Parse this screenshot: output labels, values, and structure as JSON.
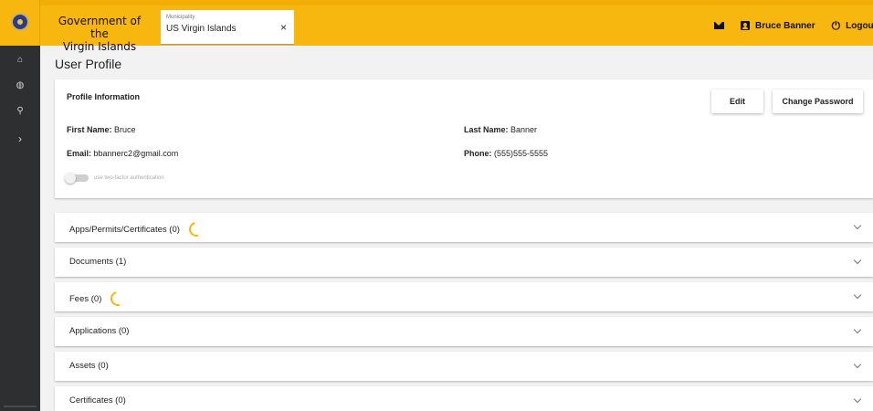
{
  "header": {
    "brand_line1": "Government of the",
    "brand_line2": "Virgin Islands",
    "municipality_label": "Municipality",
    "municipality_value": "US Virgin Islands",
    "clear_glyph": "×",
    "user_name": "Bruce Banner",
    "logout_label": "Logout",
    "power_glyph": "⏻"
  },
  "sidebar": {
    "items": [
      {
        "icon": "home-icon",
        "glyph": "⌂"
      },
      {
        "icon": "globe-icon",
        "glyph": "◍"
      },
      {
        "icon": "search-icon",
        "glyph": "⚲"
      },
      {
        "icon": "chevron-right-icon",
        "glyph": "›"
      }
    ]
  },
  "page": {
    "title": "User Profile"
  },
  "profile": {
    "heading": "Profile Information",
    "edit_label": "Edit",
    "change_password_label": "Change Password",
    "first_name_label": "First Name:",
    "first_name": "Bruce",
    "last_name_label": "Last Name:",
    "last_name": "Banner",
    "email_label": "Email:",
    "email": "bbannerc2@gmail.com",
    "phone_label": "Phone:",
    "phone": "(555)555-5555",
    "two_factor_label": "use two-factor authentication",
    "two_factor_enabled": false
  },
  "sections": [
    {
      "label": "Apps/Permits/Certificates (0)",
      "loading": true
    },
    {
      "label": "Documents (1)",
      "loading": false
    },
    {
      "label": "Fees (0)",
      "loading": true
    },
    {
      "label": "Applications (0)",
      "loading": false
    },
    {
      "label": "Assets (0)",
      "loading": false
    },
    {
      "label": "Certificates (0)",
      "loading": false
    }
  ],
  "colors": {
    "accent": "#f8b70f",
    "sidebar": "#2e2f30",
    "background": "#f2f2f2"
  }
}
